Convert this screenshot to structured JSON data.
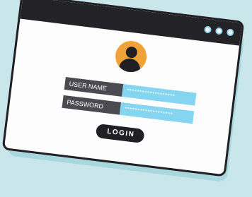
{
  "window": {
    "dots": [
      "window-dot-1",
      "window-dot-2",
      "window-dot-3"
    ]
  },
  "login_form": {
    "username_label": "USER NAME",
    "username_value": "*******************",
    "password_label": "PASSWORD",
    "password_value": "*******************",
    "login_label": "LOGIN"
  },
  "colors": {
    "background": "#c9e6ea",
    "titlebar": "#222227",
    "avatar": "#f0a238",
    "field_label_bg": "#4a4a50",
    "field_value_bg": "#86d5f0",
    "button_bg": "#202024"
  }
}
